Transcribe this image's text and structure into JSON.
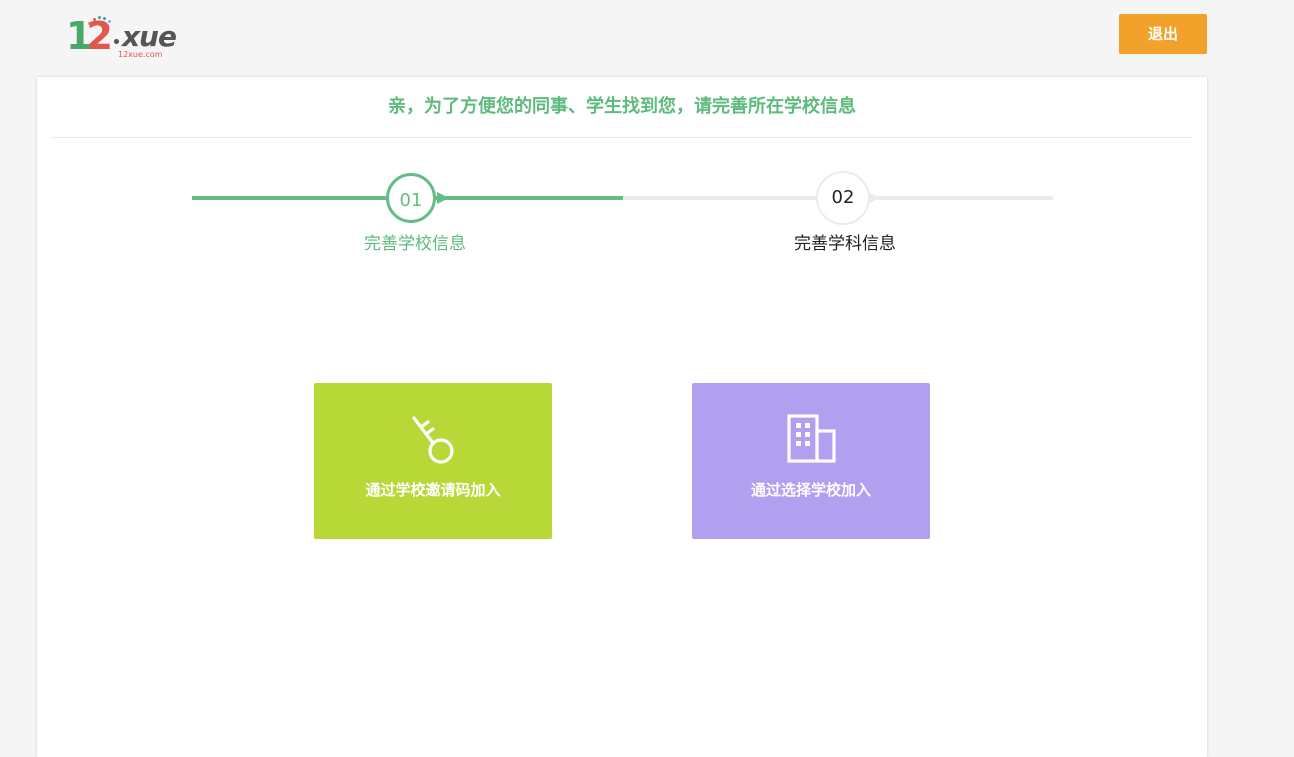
{
  "header": {
    "logo_text_1": "1",
    "logo_text_2": "2",
    "logo_text_rest": "xue",
    "logo_subtext": "12xue.com",
    "logout_label": "退出"
  },
  "notice": "亲，为了方便您的同事、学生找到您，请完善所在学校信息",
  "steps": [
    {
      "number": "01",
      "label": "完善学校信息",
      "state": "active"
    },
    {
      "number": "02",
      "label": "完善学科信息",
      "state": "pending"
    }
  ],
  "options": [
    {
      "label": "通过学校邀请码加入",
      "icon": "key-icon",
      "color": "#b8d838"
    },
    {
      "label": "通过选择学校加入",
      "icon": "building-icon",
      "color": "#b19ff0"
    }
  ],
  "colors": {
    "accent_green": "#65bd85",
    "logout_orange": "#f2a12a",
    "background": "#f5f5f5"
  }
}
